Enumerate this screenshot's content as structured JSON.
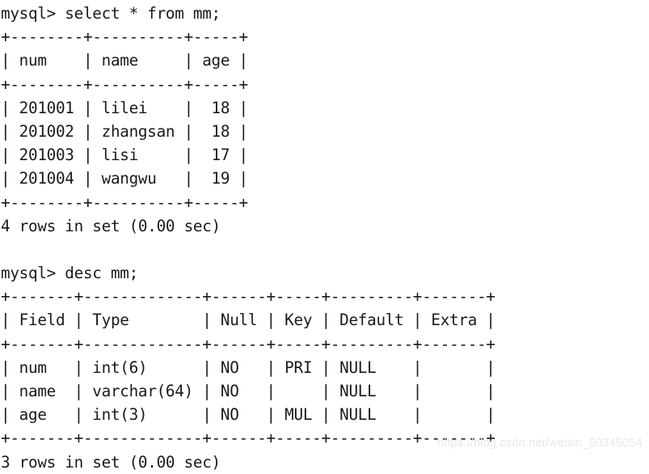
{
  "terminal": {
    "prompt": "mysql>",
    "background_color": "#ffffff",
    "text_color": "#1a1a1a",
    "blocks": [
      {
        "command_line": "mysql> select * from mm;",
        "command": "select * from mm;",
        "table": {
          "separator": "+--------+----------+-----+",
          "header_row": "| num    | name     | age |",
          "columns": [
            "num",
            "name",
            "age"
          ],
          "rows": [
            "| 201001 | lilei    |  18 |",
            "| 201002 | zhangsan |  18 |",
            "| 201003 | lisi     |  17 |",
            "| 201004 | wangwu   |  19 |"
          ],
          "data": [
            {
              "num": "201001",
              "name": "lilei",
              "age": "18"
            },
            {
              "num": "201002",
              "name": "zhangsan",
              "age": "18"
            },
            {
              "num": "201003",
              "name": "lisi",
              "age": "17"
            },
            {
              "num": "201004",
              "name": "wangwu",
              "age": "19"
            }
          ]
        },
        "status": "4 rows in set (0.00 sec)"
      },
      {
        "command_line": "mysql> desc mm;",
        "command": "desc mm;",
        "table": {
          "separator": "+-------+-------------+------+-----+---------+-------+",
          "header_row": "| Field | Type        | Null | Key | Default | Extra |",
          "columns": [
            "Field",
            "Type",
            "Null",
            "Key",
            "Default",
            "Extra"
          ],
          "rows": [
            "| num   | int(6)      | NO   | PRI | NULL    |       |",
            "| name  | varchar(64) | NO   |     | NULL    |       |",
            "| age   | int(3)      | NO   | MUL | NULL    |       |"
          ],
          "data": [
            {
              "Field": "num",
              "Type": "int(6)",
              "Null": "NO",
              "Key": "PRI",
              "Default": "NULL",
              "Extra": ""
            },
            {
              "Field": "name",
              "Type": "varchar(64)",
              "Null": "NO",
              "Key": "",
              "Default": "NULL",
              "Extra": ""
            },
            {
              "Field": "age",
              "Type": "int(3)",
              "Null": "NO",
              "Key": "MUL",
              "Default": "NULL",
              "Extra": ""
            }
          ]
        },
        "status": "3 rows in set (0.00 sec)"
      }
    ],
    "lines": [
      "mysql> select * from mm;",
      "+--------+----------+-----+",
      "| num    | name     | age |",
      "+--------+----------+-----+",
      "| 201001 | lilei    |  18 |",
      "| 201002 | zhangsan |  18 |",
      "| 201003 | lisi     |  17 |",
      "| 201004 | wangwu   |  19 |",
      "+--------+----------+-----+",
      "4 rows in set (0.00 sec)",
      " ",
      "mysql> desc mm;",
      "+-------+-------------+------+-----+---------+-------+",
      "| Field | Type        | Null | Key | Default | Extra |",
      "+-------+-------------+------+-----+---------+-------+",
      "| num   | int(6)      | NO   | PRI | NULL    |       |",
      "| name  | varchar(64) | NO   |     | NULL    |       |",
      "| age   | int(3)      | NO   | MUL | NULL    |       |",
      "+-------+-------------+------+-----+---------+-------+",
      "3 rows in set (0.00 sec)"
    ]
  },
  "watermark": {
    "text": "https://blog.csdn.net/weixin_50345054",
    "color": "#e8e8e8"
  }
}
